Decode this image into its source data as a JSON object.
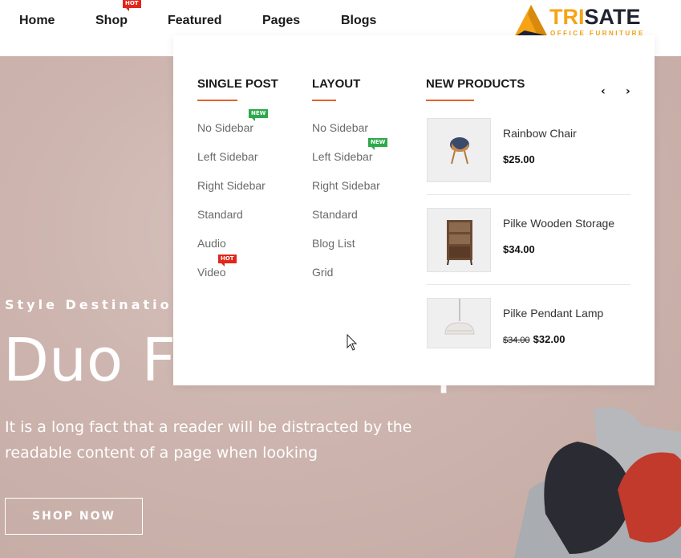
{
  "nav": {
    "items": [
      {
        "label": "Home"
      },
      {
        "label": "Shop",
        "badge": "HOT"
      },
      {
        "label": "Featured"
      },
      {
        "label": "Pages"
      },
      {
        "label": "Blogs"
      }
    ]
  },
  "logo": {
    "tri": "TRI",
    "sate": "SATE",
    "tagline": "OFFICE FURNITURE"
  },
  "mega_menu": {
    "single_post": {
      "title": "SINGLE POST",
      "links": [
        "No Sidebar",
        "Left Sidebar",
        "Right Sidebar",
        "Standard",
        "Audio",
        "Video"
      ],
      "badges": {
        "no_sidebar": "NEW",
        "video": "HOT"
      }
    },
    "layout": {
      "title": "LAYOUT",
      "links": [
        "No Sidebar",
        "Left Sidebar",
        "Right Sidebar",
        "Standard",
        "Blog List",
        "Grid"
      ],
      "badges": {
        "left_sidebar": "NEW"
      }
    },
    "new_products": {
      "title": "NEW PRODUCTS",
      "prev": "‹",
      "next": "›",
      "items": [
        {
          "name": "Rainbow Chair",
          "price": "$25.00"
        },
        {
          "name": "Pilke Wooden Storage",
          "price": "$34.00"
        },
        {
          "name": "Pilke Pendant Lamp",
          "old_price": "$34.00",
          "price": "$32.00"
        }
      ]
    }
  },
  "hero": {
    "subtitle": "Style Destination",
    "title": "Duo Floor Lamp",
    "description": "It is a long fact that a reader will be distracted by the readable content of a page when looking",
    "button": "SHOP NOW"
  },
  "colors": {
    "accent": "#e2642b",
    "hot": "#e1261c",
    "new": "#2ea94b",
    "logo_orange": "#f6a316"
  }
}
